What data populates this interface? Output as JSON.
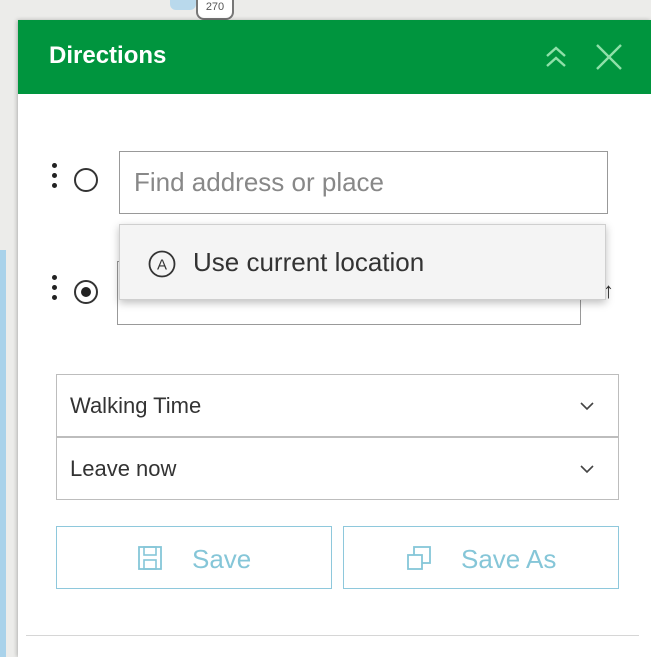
{
  "map": {
    "route_shield": "270"
  },
  "panel": {
    "title": "Directions",
    "collapse_icon": "double-chevron-up-icon",
    "close_icon": "close-icon"
  },
  "stops": [
    {
      "placeholder": "Find address or place",
      "value": "",
      "selected": false
    },
    {
      "placeholder": "",
      "value": "",
      "selected": true
    }
  ],
  "suggestions": {
    "items": [
      {
        "icon": "location-a-icon",
        "label": "Use current location"
      }
    ]
  },
  "options": {
    "travel_mode": "Walking Time",
    "depart": "Leave now"
  },
  "actions": {
    "save_label": "Save",
    "save_as_label": "Save As"
  },
  "colors": {
    "header_green": "#00953e",
    "button_blue": "#85c6d8"
  }
}
